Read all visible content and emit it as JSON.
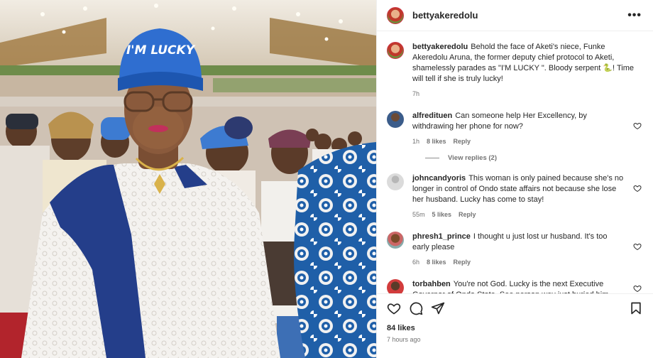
{
  "post": {
    "author": "bettyakeredolu",
    "author_avatar_icon": "profile-avatar",
    "more_icon": "more-options-icon",
    "more_label": "•••",
    "photo_cap_text": "I'M LUCKY",
    "caption": {
      "user": "bettyakeredolu",
      "text": "Behold the face of Aketi's niece, Funke Akeredolu Aruna, the former deputy chief protocol to Aketi, shamelessly parades as \"I'M LUCKY \". Bloody serpent 🐍! Time will tell if she is truly lucky!",
      "time": "7h"
    },
    "comments": [
      {
        "user": "alfredituen",
        "text": "Can someone help Her Excellency, by withdrawing her phone for now?",
        "time": "1h",
        "likes": "8 likes",
        "reply": "Reply",
        "view_replies": "View replies (2)"
      },
      {
        "user": "johncandyoris",
        "text": "This woman is only pained because she's no longer in control of Ondo state affairs not because she lose her husband. Lucky has come to stay!",
        "time": "55m",
        "likes": "5 likes",
        "reply": "Reply"
      },
      {
        "user": "phresh1_prince",
        "text": "I thought u just lost ur husband. It's too early please",
        "time": "6h",
        "likes": "8 likes",
        "reply": "Reply"
      },
      {
        "user": "torbahben",
        "text": "You're not God. Lucky is the next Executive Governor of Ondo State. See person wey just buried him",
        "time": "",
        "likes": "",
        "reply": ""
      }
    ],
    "actions": {
      "like_icon": "heart-icon",
      "comment_icon": "comment-icon",
      "share_icon": "share-icon",
      "save_icon": "bookmark-icon"
    },
    "likes_count": "84 likes",
    "posted_ago": "7 hours ago"
  }
}
